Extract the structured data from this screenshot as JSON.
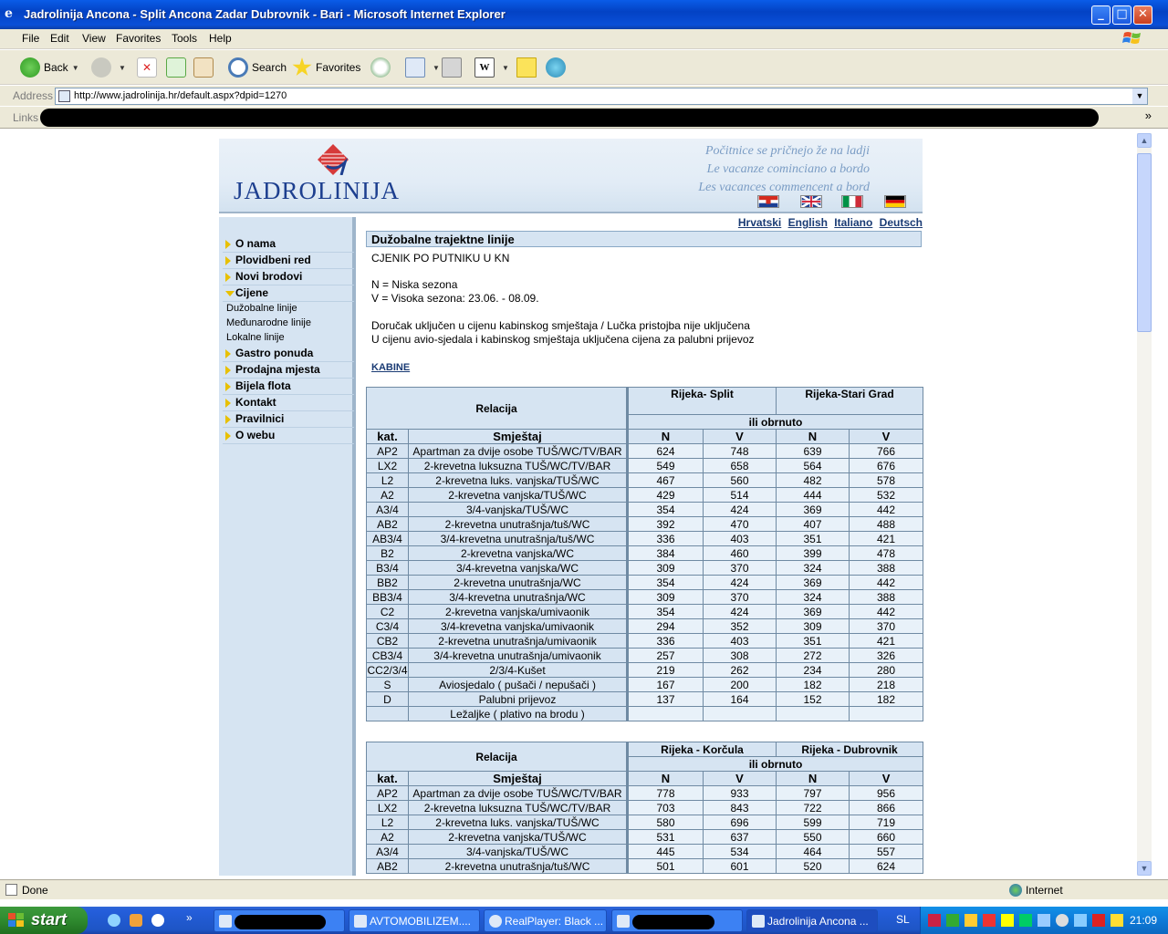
{
  "window": {
    "title": "Jadrolinija Ancona - Split Ancona Zadar Dubrovnik - Bari - Microsoft Internet Explorer",
    "btn_min": "_",
    "btn_max": "□",
    "btn_close": "✕"
  },
  "menu": [
    "File",
    "Edit",
    "View",
    "Favorites",
    "Tools",
    "Help"
  ],
  "toolbar": {
    "back": "Back",
    "search": "Search",
    "favorites": "Favorites"
  },
  "address": {
    "label": "Address",
    "url": "http://www.jadrolinija.hr/default.aspx?dpid=1270"
  },
  "links": {
    "label": "Links",
    "more": "»"
  },
  "site": {
    "logo": "JADROLINIJA",
    "slogans": [
      "Počitnice se pričnejo že na ladji",
      "Le vacanze cominciano a bordo",
      "Les vacances commencent a bord"
    ],
    "languages": [
      "Hrvatski",
      "English",
      "Italiano",
      "Deutsch"
    ]
  },
  "nav": {
    "items": [
      "O nama",
      "Plovidbeni red",
      "Novi brodovi",
      "Cijene",
      "Gastro ponuda",
      "Prodajna mjesta",
      "Bijela flota",
      "Kontakt",
      "Pravilnici",
      "O webu"
    ],
    "subitems": [
      "Dužobalne linije",
      "Međunarodne linije",
      "Lokalne linije"
    ]
  },
  "content": {
    "section_title": "Dužobalne trajektne linije",
    "heading": "CJENIK PO PUTNIKU U KN",
    "legend_n": "N = Niska sezona",
    "legend_v": "V = Visoka sezona: 23.06. - 08.09.",
    "note1": "Doručak uključen u cijenu kabinskog smještaja / Lučka pristojba nije uključena",
    "note2": "U cijenu avio-sjedala i kabinskog smještaja uključena cijena za palubni prijevoz",
    "kabine": "KABINE"
  },
  "table1": {
    "relacija": "Relacija",
    "route1": "Rijeka- Split",
    "route2": "Rijeka-Stari Grad",
    "obrnuto": "ili obrnuto",
    "col_kat": "kat.",
    "col_smjestaj": "Smještaj",
    "col_n": "N",
    "col_v": "V",
    "rows": [
      [
        "AP2",
        "Apartman za dvije osobe TUŠ/WC/TV/BAR",
        "624",
        "748",
        "639",
        "766"
      ],
      [
        "LX2",
        "2-krevetna luksuzna TUŠ/WC/TV/BAR",
        "549",
        "658",
        "564",
        "676"
      ],
      [
        "L2",
        "2-krevetna luks. vanjska/TUŠ/WC",
        "467",
        "560",
        "482",
        "578"
      ],
      [
        "A2",
        "2-krevetna vanjska/TUŠ/WC",
        "429",
        "514",
        "444",
        "532"
      ],
      [
        "A3/4",
        "3/4-vanjska/TUŠ/WC",
        "354",
        "424",
        "369",
        "442"
      ],
      [
        "AB2",
        "2-krevetna unutrašnja/tuš/WC",
        "392",
        "470",
        "407",
        "488"
      ],
      [
        "AB3/4",
        "3/4-krevetna unutrašnja/tuš/WC",
        "336",
        "403",
        "351",
        "421"
      ],
      [
        "B2",
        "2-krevetna vanjska/WC",
        "384",
        "460",
        "399",
        "478"
      ],
      [
        "B3/4",
        "3/4-krevetna vanjska/WC",
        "309",
        "370",
        "324",
        "388"
      ],
      [
        "BB2",
        "2-krevetna unutrašnja/WC",
        "354",
        "424",
        "369",
        "442"
      ],
      [
        "BB3/4",
        "3/4-krevetna unutrašnja/WC",
        "309",
        "370",
        "324",
        "388"
      ],
      [
        "C2",
        "2-krevetna vanjska/umivaonik",
        "354",
        "424",
        "369",
        "442"
      ],
      [
        "C3/4",
        "3/4-krevetna vanjska/umivaonik",
        "294",
        "352",
        "309",
        "370"
      ],
      [
        "CB2",
        "2-krevetna unutrašnja/umivaonik",
        "336",
        "403",
        "351",
        "421"
      ],
      [
        "CB3/4",
        "3/4-krevetna unutrašnja/umivaonik",
        "257",
        "308",
        "272",
        "326"
      ],
      [
        "CC2/3/4",
        "2/3/4-Kušet",
        "219",
        "262",
        "234",
        "280"
      ],
      [
        "S",
        "Aviosjedalo ( pušači / nepušači )",
        "167",
        "200",
        "182",
        "218"
      ],
      [
        "D",
        "Palubni prijevoz",
        "137",
        "164",
        "152",
        "182"
      ],
      [
        "",
        "Ležaljke ( plativo na brodu )",
        "",
        "",
        "",
        ""
      ]
    ]
  },
  "table2": {
    "relacija": "Relacija",
    "route1": "Rijeka - Korčula",
    "route2": "Rijeka - Dubrovnik",
    "obrnuto": "ili obrnuto",
    "col_kat": "kat.",
    "col_smjestaj": "Smještaj",
    "col_n": "N",
    "col_v": "V",
    "rows": [
      [
        "AP2",
        "Apartman za dvije osobe TUŠ/WC/TV/BAR",
        "778",
        "933",
        "797",
        "956"
      ],
      [
        "LX2",
        "2-krevetna luksuzna TUŠ/WC/TV/BAR",
        "703",
        "843",
        "722",
        "866"
      ],
      [
        "L2",
        "2-krevetna luks. vanjska/TUŠ/WC",
        "580",
        "696",
        "599",
        "719"
      ],
      [
        "A2",
        "2-krevetna vanjska/TUŠ/WC",
        "531",
        "637",
        "550",
        "660"
      ],
      [
        "A3/4",
        "3/4-vanjska/TUŠ/WC",
        "445",
        "534",
        "464",
        "557"
      ],
      [
        "AB2",
        "2-krevetna unutrašnja/tuš/WC",
        "501",
        "601",
        "520",
        "624"
      ]
    ]
  },
  "status": {
    "text": "Done",
    "zone": "Internet"
  },
  "taskbar": {
    "start": "start",
    "tasks": [
      "AVTOMOBILIZEM....",
      "RealPlayer: Black ...",
      "Jadrolinija Ancona ..."
    ],
    "lang": "SL",
    "clock": "21:09"
  }
}
